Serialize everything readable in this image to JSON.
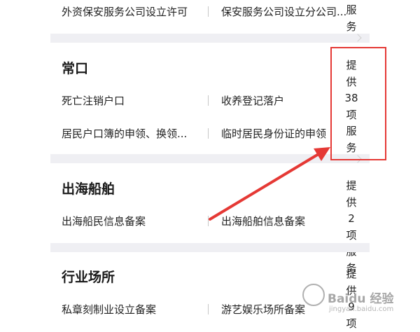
{
  "top_row": {
    "item1": "外资保安服务公司设立许可",
    "item2": "保安服务公司设立分公司..."
  },
  "top_service_fragment": [
    "服",
    "务"
  ],
  "sections": [
    {
      "title": "常口",
      "items": [
        "死亡注销户口",
        "收养登记落户",
        "居民户口簿的申领、换领...",
        "临时居民身份证的申领..."
      ],
      "service_count_vertical": [
        "提",
        "供",
        "38",
        "项",
        "服",
        "务"
      ]
    },
    {
      "title": "出海船舶",
      "items": [
        "出海船民信息备案",
        "出海船舶信息备案"
      ],
      "service_count_vertical": [
        "提",
        "供",
        "2",
        "项",
        "服",
        "务"
      ]
    },
    {
      "title": "行业场所",
      "items": [
        "私章刻制业设立备案",
        "游艺娱乐场所备案"
      ],
      "service_count_vertical": [
        "提",
        "供",
        "9",
        "项"
      ]
    }
  ],
  "watermark": {
    "text": "Baidu 经验",
    "url": "jingyan.baidu.com"
  },
  "colors": {
    "highlight": "#e53935",
    "separator": "#efeff3",
    "text": "#222222"
  }
}
